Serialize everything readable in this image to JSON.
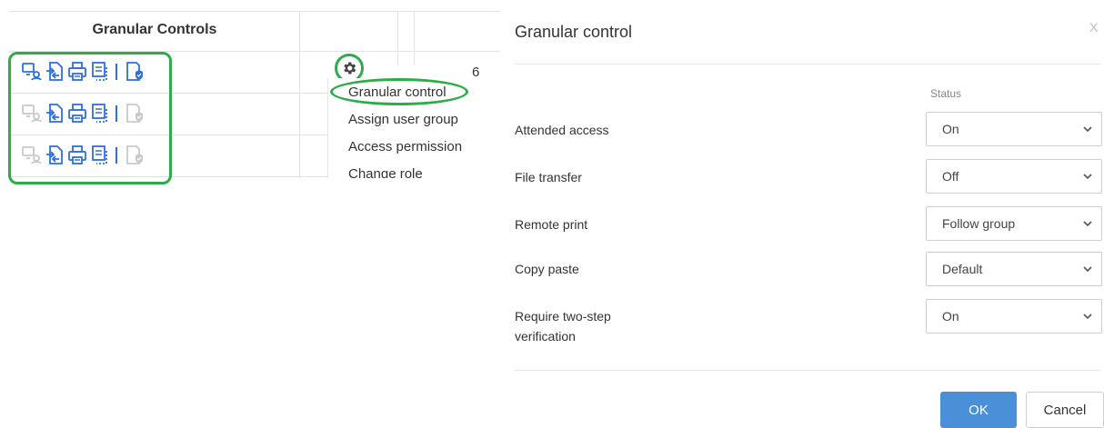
{
  "table": {
    "header": "Granular Controls",
    "count_text": "6",
    "rows": [
      {
        "icons": [
          "remote-desktop-icon",
          "file-transfer-icon",
          "remote-print-icon",
          "copy-paste-icon",
          "two-step-verification-icon"
        ],
        "enabled": [
          true,
          true,
          true,
          true,
          true
        ]
      },
      {
        "icons": [
          "remote-desktop-icon",
          "file-transfer-icon",
          "remote-print-icon",
          "copy-paste-icon",
          "two-step-verification-icon"
        ],
        "enabled": [
          false,
          true,
          true,
          true,
          false
        ]
      },
      {
        "icons": [
          "remote-desktop-icon",
          "file-transfer-icon",
          "remote-print-icon",
          "copy-paste-icon",
          "two-step-verification-icon"
        ],
        "enabled": [
          false,
          true,
          true,
          true,
          false
        ]
      }
    ]
  },
  "context_menu": {
    "items": [
      "Granular control",
      "Assign user group",
      "Access permission",
      "Change role"
    ]
  },
  "dialog": {
    "title": "Granular control",
    "close_label": "X",
    "status_header": "Status",
    "rows": [
      {
        "label": "Attended access",
        "value": "On"
      },
      {
        "label": "File transfer",
        "value": "Off"
      },
      {
        "label": "Remote print",
        "value": "Follow group"
      },
      {
        "label": "Copy paste",
        "value": "Default"
      },
      {
        "label_line1": "Require two-step",
        "label_line2": "verification",
        "value": "On"
      }
    ],
    "ok_label": "OK",
    "cancel_label": "Cancel"
  },
  "colors": {
    "icon_active": "#2f6fdc",
    "icon_disabled": "#c9c9c9",
    "highlight": "#2eac4a",
    "primary_button": "#4a90d9"
  }
}
